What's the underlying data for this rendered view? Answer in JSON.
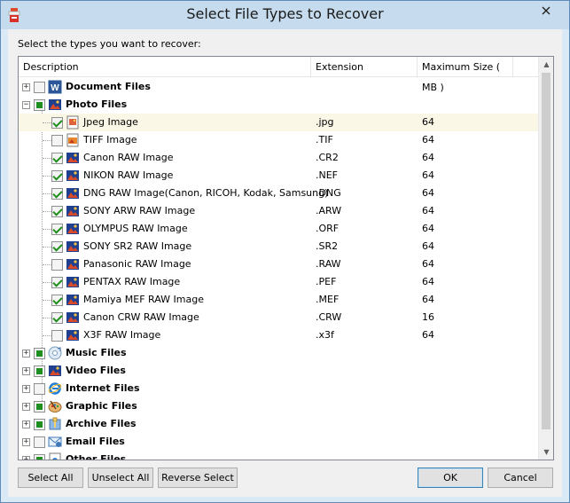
{
  "window": {
    "title": "Select File Types to Recover"
  },
  "prompt": "Select the types you want to recover:",
  "columns": {
    "description": "Description",
    "extension": "Extension",
    "max_size": "Maximum Size ( MB )"
  },
  "categories": [
    {
      "label": "Document Files",
      "state": "unchecked",
      "expanded": false,
      "icon": "word-document-icon"
    },
    {
      "label": "Photo Files",
      "state": "partial",
      "expanded": true,
      "icon": "photo-icon"
    },
    {
      "label": "Music Files",
      "state": "partial",
      "expanded": false,
      "icon": "music-icon"
    },
    {
      "label": "Video Files",
      "state": "partial",
      "expanded": false,
      "icon": "video-icon"
    },
    {
      "label": "Internet Files",
      "state": "unchecked",
      "expanded": false,
      "icon": "internet-explorer-icon"
    },
    {
      "label": "Graphic Files",
      "state": "partial",
      "expanded": false,
      "icon": "graphic-palette-icon"
    },
    {
      "label": "Archive Files",
      "state": "partial",
      "expanded": false,
      "icon": "archive-icon"
    },
    {
      "label": "Email Files",
      "state": "unchecked",
      "expanded": false,
      "icon": "email-icon"
    },
    {
      "label": "Other Files",
      "state": "partial",
      "expanded": false,
      "icon": "other-files-icon"
    }
  ],
  "photo_items": [
    {
      "label": "Jpeg Image",
      "ext": ".jpg",
      "size": "64",
      "checked": true,
      "icon": "jpeg-icon"
    },
    {
      "label": "TIFF Image",
      "ext": ".TIF",
      "size": "64",
      "checked": false,
      "icon": "tiff-icon"
    },
    {
      "label": "Canon RAW Image",
      "ext": ".CR2",
      "size": "64",
      "checked": true,
      "icon": "raw-image-icon"
    },
    {
      "label": "NIKON RAW Image",
      "ext": ".NEF",
      "size": "64",
      "checked": true,
      "icon": "raw-image-icon"
    },
    {
      "label": "DNG RAW Image(Canon, RICOH, Kodak, Samsung)",
      "ext": ".DNG",
      "size": "64",
      "checked": true,
      "icon": "raw-image-icon"
    },
    {
      "label": "SONY ARW RAW Image",
      "ext": ".ARW",
      "size": "64",
      "checked": true,
      "icon": "raw-image-icon"
    },
    {
      "label": "OLYMPUS RAW Image",
      "ext": ".ORF",
      "size": "64",
      "checked": true,
      "icon": "raw-image-icon"
    },
    {
      "label": "SONY SR2 RAW Image",
      "ext": ".SR2",
      "size": "64",
      "checked": true,
      "icon": "raw-image-icon"
    },
    {
      "label": "Panasonic RAW Image",
      "ext": ".RAW",
      "size": "64",
      "checked": false,
      "icon": "raw-image-icon"
    },
    {
      "label": "PENTAX RAW Image",
      "ext": ".PEF",
      "size": "64",
      "checked": true,
      "icon": "raw-image-icon"
    },
    {
      "label": "Mamiya MEF RAW Image",
      "ext": ".MEF",
      "size": "64",
      "checked": true,
      "icon": "raw-image-icon"
    },
    {
      "label": "Canon CRW RAW Image",
      "ext": ".CRW",
      "size": "16",
      "checked": true,
      "icon": "raw-image-icon"
    },
    {
      "label": "X3F RAW Image",
      "ext": ".x3f",
      "size": "64",
      "checked": false,
      "icon": "raw-image-icon"
    }
  ],
  "buttons": {
    "select_all": "Select All",
    "unselect_all": "Unselect All",
    "reverse_select": "Reverse Select",
    "ok": "OK",
    "cancel": "Cancel"
  },
  "colors": {
    "title_bar": "#c6dcee",
    "check_green": "#1e8f1e",
    "selected_row": "#fbf7e6"
  }
}
